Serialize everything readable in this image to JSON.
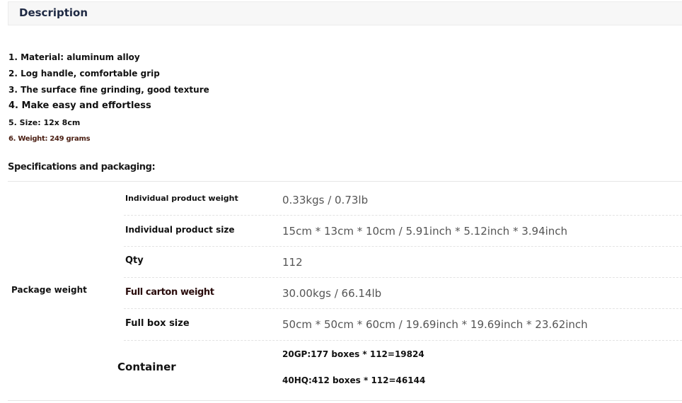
{
  "description": {
    "title": "Description"
  },
  "features": [
    "1. Material: aluminum alloy",
    "2. Log handle, comfortable grip",
    "3. The surface fine grinding, good texture",
    "4. Make easy and effortless",
    "5. Size: 12x 8cm",
    "6. Weight: 249 grams"
  ],
  "specs": {
    "heading": "Specifications and packaging:",
    "package_label": "Package weight",
    "rows": [
      {
        "label": "Individual product weight",
        "value": "0.33kgs / 0.73lb"
      },
      {
        "label": "Individual product size",
        "value": "15cm * 13cm * 10cm / 5.91inch * 5.12inch * 3.94inch"
      },
      {
        "label": "Qty",
        "value": "112"
      },
      {
        "label": "Full carton weight",
        "value": "30.00kgs / 66.14lb"
      },
      {
        "label": "Full box size",
        "value": "50cm * 50cm * 60cm / 19.69inch * 19.69inch * 23.62inch"
      }
    ],
    "container": {
      "label": "Container",
      "values": [
        "20GP:177 boxes * 112=19824",
        "40HQ:412 boxes * 112=46144"
      ]
    }
  }
}
